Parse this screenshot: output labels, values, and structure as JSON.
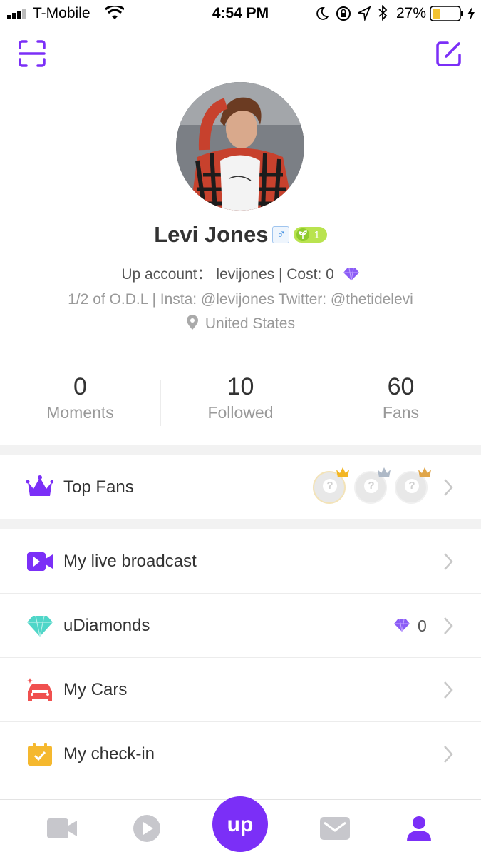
{
  "status_bar": {
    "carrier": "T-Mobile",
    "time": "4:54 PM",
    "battery": "27%"
  },
  "header": {
    "scan_icon": "scan-icon",
    "edit_icon": "edit-icon"
  },
  "profile": {
    "name": "Levi Jones",
    "gender_symbol": "♂",
    "level": "1",
    "account_line": "Up account： levijones | Cost: 0",
    "bio": "1/2 of O.D.L | Insta: @levijones Twitter: @thetidelevi",
    "location": "United States"
  },
  "stats": [
    {
      "value": "0",
      "label": "Moments"
    },
    {
      "value": "10",
      "label": "Followed"
    },
    {
      "value": "60",
      "label": "Fans"
    }
  ],
  "menu": {
    "top_fans": "Top Fans",
    "live_broadcast": "My live broadcast",
    "udiamonds": "uDiamonds",
    "udiamonds_value": "0",
    "cars": "My Cars",
    "checkin": "My check-in"
  },
  "tabbar": {
    "center_logo": "up"
  },
  "colors": {
    "accent": "#7b2ff7",
    "diamond": "#8b5cf6",
    "teal": "#4fd6c8",
    "car": "#f0504f",
    "checkin": "#f5b82e"
  }
}
